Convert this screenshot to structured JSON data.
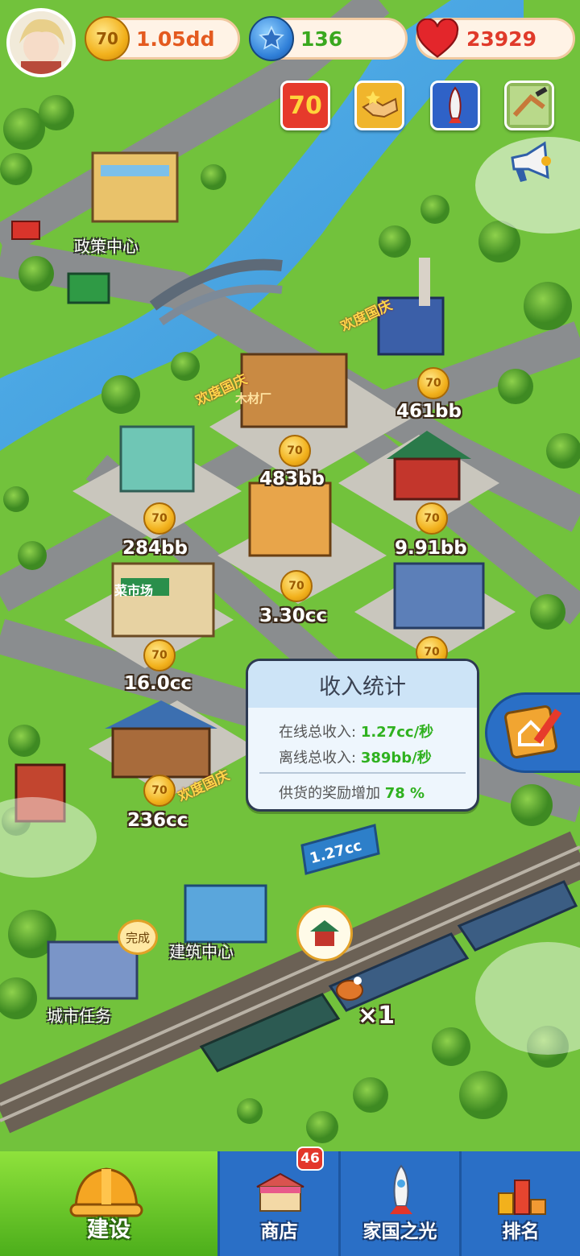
{
  "top_bar": {
    "coins": "1.05dd",
    "gems": "136",
    "hearts": "23929",
    "coin_icon_text": "70"
  },
  "event_buttons": [
    {
      "icon": "anniversary-70-icon"
    },
    {
      "icon": "handshake-icon"
    },
    {
      "icon": "rocket-event-icon"
    },
    {
      "icon": "city-map-icon"
    }
  ],
  "city_labels": {
    "policy_center": "政策中心",
    "building_center": "建筑中心",
    "city_task": "城市任务",
    "complete_badge": "完成"
  },
  "buildings": [
    {
      "name": "power-plant",
      "income": "461bb"
    },
    {
      "name": "lumber-mill",
      "income": "483bb"
    },
    {
      "name": "pavilion",
      "income": "9.91bb"
    },
    {
      "name": "hardware-store",
      "income": "284bb"
    },
    {
      "name": "department-store",
      "income": "3.30cc"
    },
    {
      "name": "vegetable-market",
      "income": "16.0cc"
    },
    {
      "name": "wooden-house",
      "income": "236cc"
    }
  ],
  "signs": {
    "market_sign": "菜市场",
    "billboard": "1.27cc",
    "festival_banner": "欢度国庆",
    "lumber_sign": "木材厂"
  },
  "train": {
    "cargo_count": "×1"
  },
  "income_panel": {
    "title": "收入统计",
    "online_label": "在线总收入:",
    "online_value": "1.27cc/秒",
    "offline_label": "离线总收入:",
    "offline_value": "389bb/秒",
    "bonus_label": "供货的奖励增加",
    "bonus_value": "78 %"
  },
  "nav": {
    "build": "建设",
    "shop": "商店",
    "shop_badge": "46",
    "homeland": "家国之光",
    "rank": "排名"
  },
  "colors": {
    "grass": "#6fbf3a",
    "river": "#4aa6e6",
    "road": "#8a8d8f",
    "nav_blue": "#2a6fc6",
    "nav_active": "#5cbf22"
  }
}
